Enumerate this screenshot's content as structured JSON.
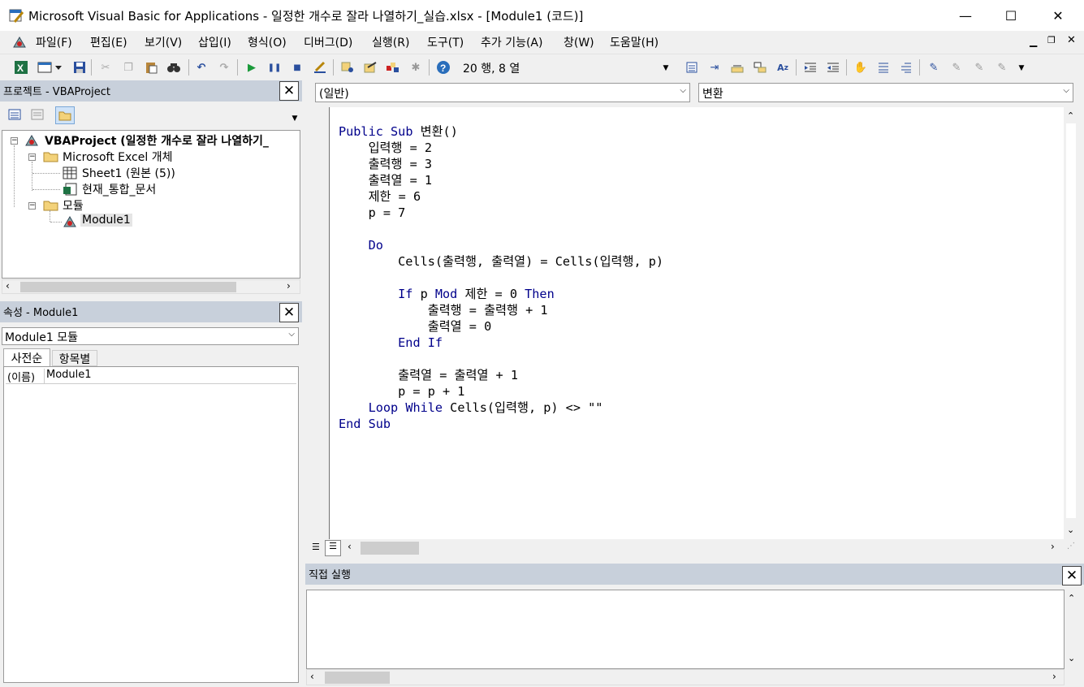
{
  "window": {
    "title": "Microsoft Visual Basic for Applications - 일정한 개수로 잘라 나열하기_실습.xlsx - [Module1 (코드)]",
    "minimize": "—",
    "maximize": "☐",
    "close": "✕"
  },
  "menu": [
    "파일(F)",
    "편집(E)",
    "보기(V)",
    "삽입(I)",
    "형식(O)",
    "디버그(D)",
    "실행(R)",
    "도구(T)",
    "추가 기능(A)",
    "창(W)",
    "도움말(H)"
  ],
  "toolbar": {
    "status": "20 행, 8 열"
  },
  "project": {
    "title": "프로젝트 - VBAProject",
    "close": "✕",
    "root": "VBAProject (일정한 개수로 잘라 나열하기_",
    "folder_excel": "Microsoft Excel 개체",
    "sheet1": "Sheet1 (원본 (5))",
    "thisworkbook": "현재_통합_문서",
    "folder_modules": "모듈",
    "module1": "Module1"
  },
  "properties": {
    "title": "속성 - Module1",
    "close": "✕",
    "object_select": "Module1 모듈",
    "tab_alpha": "사전순",
    "tab_category": "항목별",
    "row_name": "(이름)",
    "row_value": "Module1"
  },
  "code": {
    "object_combo": "(일반)",
    "proc_combo": "변환",
    "lines": [
      "",
      "Public Sub 변환()",
      "    입력행 = 2",
      "    출력행 = 3",
      "    출력열 = 1",
      "    제한 = 6",
      "    p = 7",
      "",
      "    Do",
      "        Cells(출력행, 출력열) = Cells(입력행, p)",
      "",
      "        If p Mod 제한 = 0 Then",
      "            출력행 = 출력행 + 1",
      "            출력열 = 0",
      "        End If",
      "",
      "        출력열 = 출력열 + 1",
      "        p = p + 1",
      "    Loop While Cells(입력행, p) <> \"\"",
      "End Sub"
    ]
  },
  "immediate": {
    "title": "직접 실행",
    "close": "✕"
  },
  "colors": {
    "keyword": "#00008b",
    "panel_title": "#c8d0db"
  }
}
